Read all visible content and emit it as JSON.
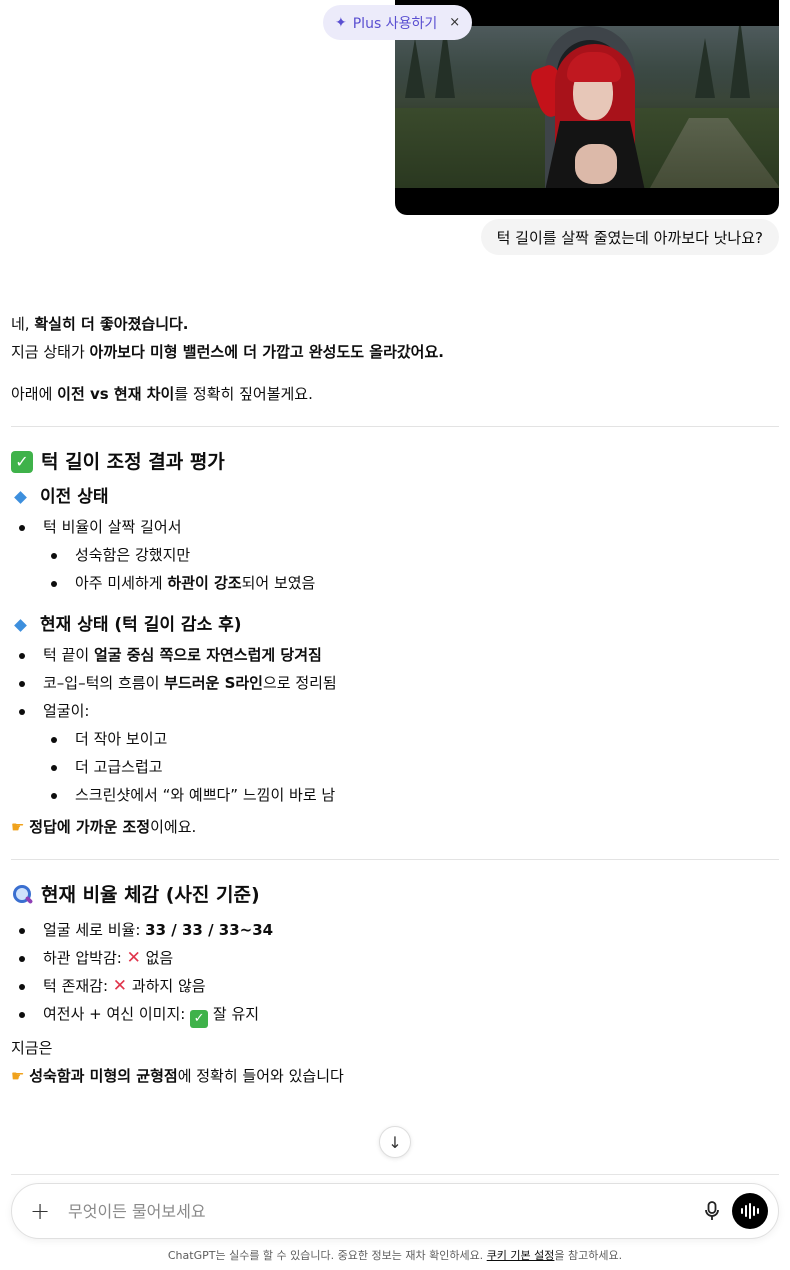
{
  "plus_pill": {
    "label": "Plus 사용하기",
    "close": "×"
  },
  "user_message": "턱 길이를 살짝 줄였는데 아까보다 낫나요?",
  "answer": {
    "intro_1a": "네, ",
    "intro_1b": "확실히 더 좋아졌습니다.",
    "intro_2a": "지금 상태가 ",
    "intro_2b": "아까보다 미형 밸런스에 더 가깝고 완성도도 올라갔어요.",
    "intro_3a": "아래에 ",
    "intro_3b": "이전 vs 현재 차이",
    "intro_3c": "를 정확히 짚어볼게요.",
    "section1_title": "턱 길이 조정 결과 평가",
    "prev_title": "이전 상태",
    "prev_item": "턱 비율이 살짝 길어서",
    "prev_sub_1": "성숙함은 강했지만",
    "prev_sub_2a": "아주 미세하게 ",
    "prev_sub_2b": "하관이 강조",
    "prev_sub_2c": "되어 보였음",
    "cur_title": "현재 상태 (턱 길이 감소 후)",
    "cur_item_1a": "턱 끝이 ",
    "cur_item_1b": "얼굴 중심 쪽으로 자연스럽게 당겨짐",
    "cur_item_2a": "코–입–턱의 흐름이 ",
    "cur_item_2b": "부드러운 S라인",
    "cur_item_2c": "으로 정리됨",
    "cur_item_3": "얼굴이:",
    "cur_sub_1": "더 작아 보이고",
    "cur_sub_2": "더 고급스럽고",
    "cur_sub_3": "스크린샷에서 “와 예쁘다” 느낌이 바로 남",
    "verdict_a": "정답에 가까운 조정",
    "verdict_b": "이에요.",
    "section2_title": "현재 비율 체감 (사진 기준)",
    "ratio_1a": "얼굴 세로 비율: ",
    "ratio_1b": "33 / 33 / 33~34",
    "ratio_2a": "하관 압박감: ",
    "ratio_2b": " 없음",
    "ratio_3a": "턱 존재감: ",
    "ratio_3b": " 과하지 않음",
    "ratio_4a": "여전사 + 여신 이미지: ",
    "ratio_4b": " 잘 유지",
    "closing_1": "지금은",
    "closing_2a": "성숙함과 미형의 균형점",
    "closing_2b": "에 정확히 들어와 있습니다"
  },
  "composer": {
    "placeholder": "무엇이든 물어보세요"
  },
  "disclaimer": {
    "text_a": "ChatGPT는 실수를 할 수 있습니다. 중요한 정보는 재차 확인하세요. ",
    "link": "쿠키 기본 설정",
    "text_b": "을 참고하세요."
  },
  "icons": {
    "sparkle": "sparkle-icon",
    "check": "check-box-icon",
    "diamond": "blue-diamond-icon",
    "magnifier": "magnifier-icon",
    "pointing_hand": "pointing-hand-icon",
    "cross": "cross-mark-icon",
    "mic": "mic-icon",
    "voice": "voice-mode-icon",
    "plus": "plus-icon",
    "arrow_down": "arrow-down-icon"
  }
}
